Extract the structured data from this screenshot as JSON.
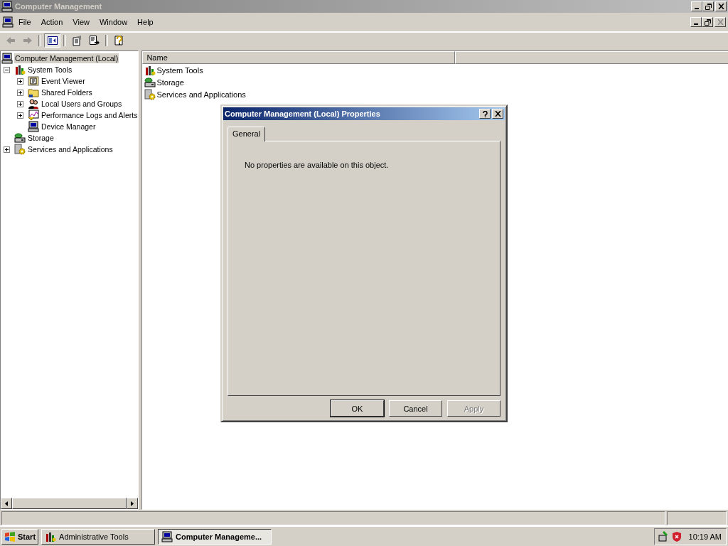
{
  "window": {
    "title": "Computer Management"
  },
  "menu": [
    "File",
    "Action",
    "View",
    "Window",
    "Help"
  ],
  "toolbar": [
    {
      "kind": "back",
      "disabled": true,
      "pressed": false
    },
    {
      "kind": "forward",
      "disabled": true,
      "pressed": false
    },
    {
      "kind": "tree",
      "disabled": false,
      "pressed": true
    },
    {
      "kind": "properties",
      "disabled": false,
      "pressed": false
    },
    {
      "kind": "export",
      "disabled": false,
      "pressed": false
    },
    {
      "kind": "help",
      "disabled": false,
      "pressed": false
    }
  ],
  "tree": [
    {
      "label": "Computer Management (Local)",
      "kind": "computer",
      "selected": true,
      "children": [
        {
          "label": "System Tools",
          "kind": "tools",
          "expanded": true,
          "selected": false,
          "children": [
            {
              "label": "Event Viewer",
              "kind": "event",
              "expanded": false,
              "selected": false
            },
            {
              "label": "Shared Folders",
              "kind": "folder",
              "expanded": false,
              "selected": false
            },
            {
              "label": "Local Users and Groups",
              "kind": "users",
              "expanded": false,
              "selected": false
            },
            {
              "label": "Performance Logs and Alerts",
              "kind": "perf",
              "expanded": false,
              "selected": false
            },
            {
              "label": "Device Manager",
              "kind": "computer",
              "selected": false
            }
          ]
        },
        {
          "label": "Storage",
          "kind": "storage",
          "selected": false
        },
        {
          "label": "Services and Applications",
          "kind": "services",
          "expanded": false,
          "selected": false
        }
      ]
    }
  ],
  "list": {
    "columns": [
      "Name"
    ],
    "rows": [
      {
        "label": "System Tools",
        "kind": "tools"
      },
      {
        "label": "Storage",
        "kind": "storage"
      },
      {
        "label": "Services and Applications",
        "kind": "services"
      }
    ]
  },
  "dialog": {
    "title": "Computer Management (Local) Properties",
    "tabs": [
      {
        "label": "General",
        "selected": true
      }
    ],
    "message": "No properties are available on this object.",
    "buttons": [
      {
        "label": "OK",
        "default": true,
        "disabled": false
      },
      {
        "label": "Cancel",
        "default": false,
        "disabled": false
      },
      {
        "label": "Apply",
        "default": false,
        "disabled": true
      }
    ]
  },
  "taskbar": {
    "start": "Start",
    "tasks": [
      {
        "label": "Administrative Tools",
        "kind": "tools",
        "selected": false
      },
      {
        "label": "Computer Manageme...",
        "kind": "computer",
        "selected": true
      }
    ],
    "clock": "10:19 AM"
  }
}
